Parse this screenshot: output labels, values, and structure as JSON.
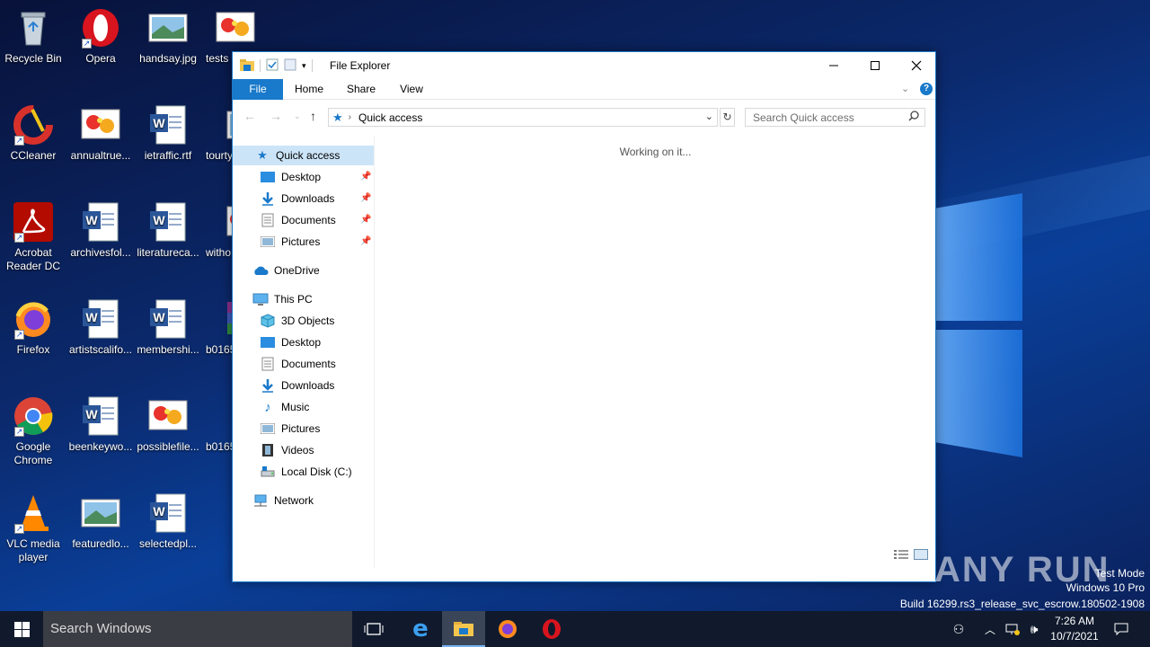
{
  "desktop": {
    "icons": [
      {
        "label": "Recycle Bin"
      },
      {
        "label": "Opera"
      },
      {
        "label": "handsay.jpg"
      },
      {
        "label": "tests"
      },
      {
        "label": "CCleaner"
      },
      {
        "label": "annualtrue..."
      },
      {
        "label": "ietraffic.rtf"
      },
      {
        "label": "tourty"
      },
      {
        "label": "Acrobat Reader DC"
      },
      {
        "label": "archivesfol..."
      },
      {
        "label": "literatureca..."
      },
      {
        "label": "witho"
      },
      {
        "label": "Firefox"
      },
      {
        "label": "artistscalifo..."
      },
      {
        "label": "membershi..."
      },
      {
        "label": "b0165"
      },
      {
        "label": "Google Chrome"
      },
      {
        "label": "beenkeywo..."
      },
      {
        "label": "possiblefile..."
      },
      {
        "label": "b0165"
      },
      {
        "label": "VLC media player"
      },
      {
        "label": "featuredlo..."
      },
      {
        "label": "selectedpl..."
      }
    ]
  },
  "explorer": {
    "title": "File Explorer",
    "tabs": {
      "file": "File",
      "home": "Home",
      "share": "Share",
      "view": "View"
    },
    "address": {
      "location": "Quick access"
    },
    "search": {
      "placeholder": "Search Quick access"
    },
    "nav": {
      "quick_access": "Quick access",
      "qa_desktop": "Desktop",
      "qa_downloads": "Downloads",
      "qa_documents": "Documents",
      "qa_pictures": "Pictures",
      "onedrive": "OneDrive",
      "this_pc": "This PC",
      "pc_3d": "3D Objects",
      "pc_desktop": "Desktop",
      "pc_documents": "Documents",
      "pc_downloads": "Downloads",
      "pc_music": "Music",
      "pc_pictures": "Pictures",
      "pc_videos": "Videos",
      "pc_localdisk": "Local Disk (C:)",
      "network": "Network"
    },
    "status": "Working on it..."
  },
  "taskbar": {
    "search_placeholder": "Search Windows",
    "time": "7:26 AM",
    "date": "10/7/2021"
  },
  "watermark": {
    "line1": "Test Mode",
    "line2": "Windows 10 Pro",
    "line3": "Build 16299.rs3_release_svc_escrow.180502-1908",
    "brand": "ANY RUN"
  },
  "colors": {
    "accent": "#1979ca",
    "taskbar": "#101a2c",
    "help": "#1979ca"
  }
}
